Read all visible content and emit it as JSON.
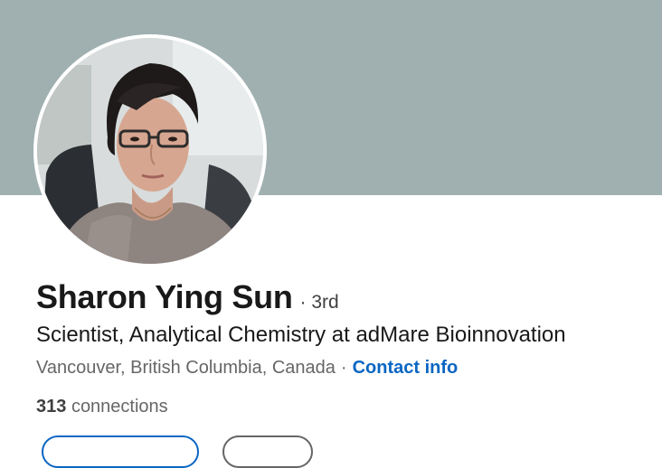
{
  "profile": {
    "name": "Sharon Ying Sun",
    "degree": "· 3rd",
    "headline": "Scientist, Analytical Chemistry at adMare Bioinnovation",
    "location": "Vancouver, British Columbia, Canada",
    "separator": "·",
    "contact_label": "Contact info",
    "connections_count": "313",
    "connections_label": "connections"
  },
  "colors": {
    "banner": "#a0b0b1",
    "link": "#0a66c2",
    "text_primary": "#191919",
    "text_secondary": "#666666"
  },
  "icons": {
    "avatar": "profile-photo"
  }
}
